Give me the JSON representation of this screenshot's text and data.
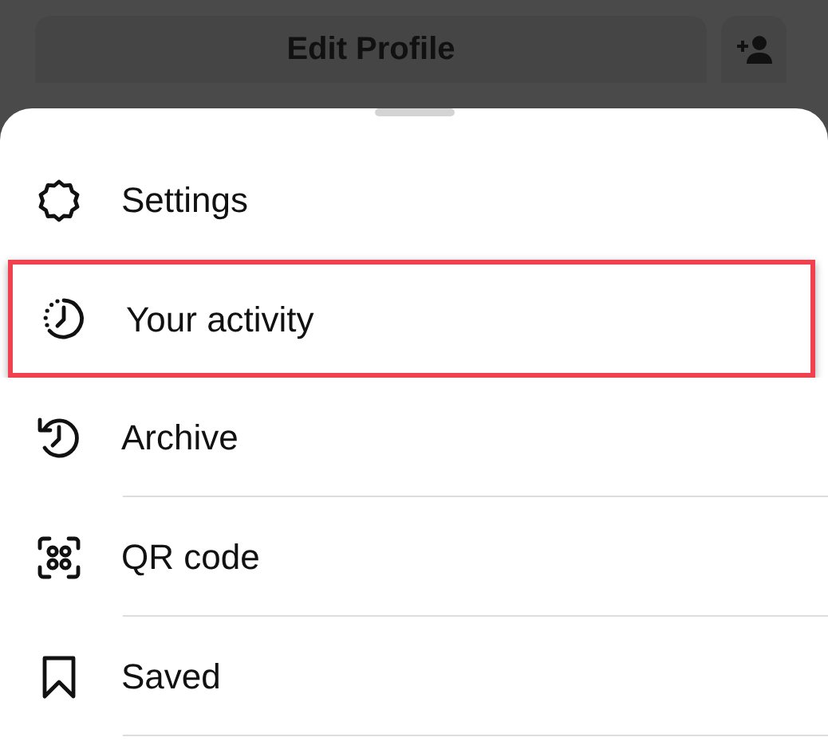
{
  "top_bar": {
    "edit_profile_button": "Edit Profile"
  },
  "menu": {
    "items": [
      {
        "label": "Settings",
        "highlighted": false,
        "divider_below": false
      },
      {
        "label": "Your activity",
        "highlighted": true,
        "divider_below": false
      },
      {
        "label": "Archive",
        "highlighted": false,
        "divider_below": true
      },
      {
        "label": "QR code",
        "highlighted": false,
        "divider_below": true
      },
      {
        "label": "Saved",
        "highlighted": false,
        "divider_below": true
      }
    ]
  }
}
